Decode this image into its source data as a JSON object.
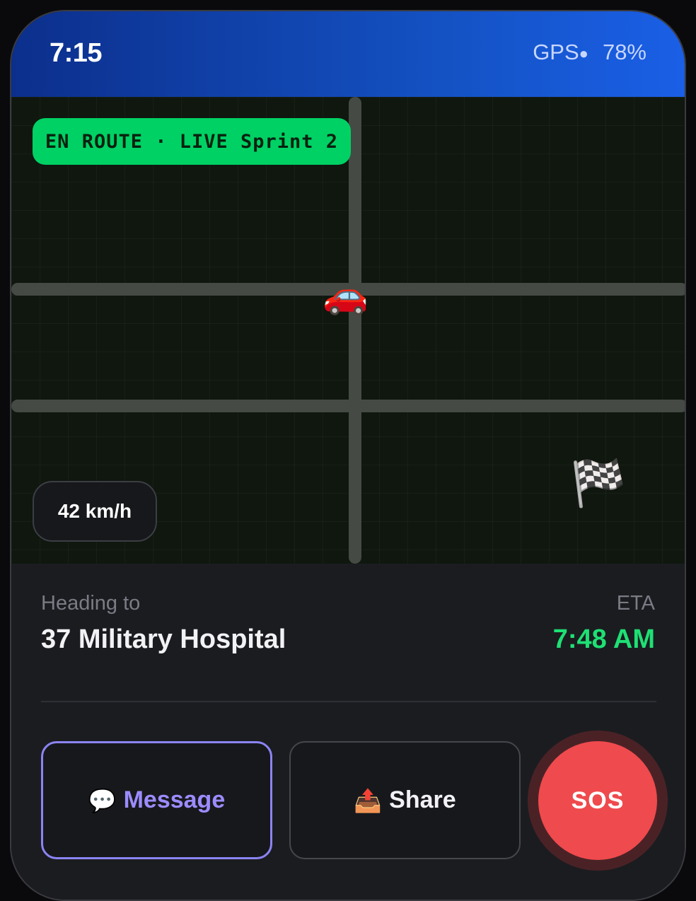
{
  "status_bar": {
    "time": "7:15",
    "gps_label": "GPS",
    "gps_dot": "●",
    "battery": "78%"
  },
  "map": {
    "status_pill": "EN ROUTE · LIVE Sprint 2",
    "vehicle_icon": "🚗",
    "destination_icon": "🏁",
    "speed": "42 km/h"
  },
  "trip": {
    "heading_label": "Heading to",
    "destination": "37 Military Hospital",
    "eta_label": "ETA",
    "eta": "7:48 AM"
  },
  "actions": {
    "message": {
      "icon": "💬",
      "label": "Message"
    },
    "share": {
      "icon": "📤",
      "label": "Share"
    },
    "sos": {
      "label": "SOS"
    }
  },
  "colors": {
    "accent_green": "#00d164",
    "eta_green": "#1ee074",
    "message_purple": "#9b8cff",
    "sos_red": "#ef4a4d",
    "header_blue": "#1452c4"
  }
}
